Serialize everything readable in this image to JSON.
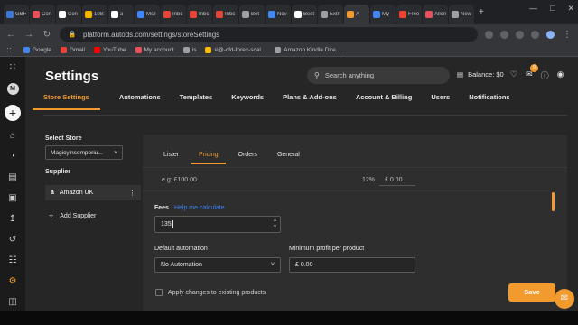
{
  "browser": {
    "tabs": [
      {
        "label": "GBF",
        "color": "#3c78d8"
      },
      {
        "label": "Con",
        "color": "#e8505b"
      },
      {
        "label": "Con",
        "color": "#ffffff"
      },
      {
        "label": "108:",
        "color": "#f4b400"
      },
      {
        "label": "a",
        "color": "#ffffff"
      },
      {
        "label": "McT",
        "color": "#4285f4"
      },
      {
        "label": "Inbc",
        "color": "#ea4335"
      },
      {
        "label": "Inbc",
        "color": "#ea4335"
      },
      {
        "label": "Inbc",
        "color": "#ea4335"
      },
      {
        "label": "Bet",
        "color": "#9aa0a6"
      },
      {
        "label": "Nov",
        "color": "#4285f4"
      },
      {
        "label": "Best",
        "color": "#ffffff"
      },
      {
        "label": "Extr",
        "color": "#9aa0a6"
      },
      {
        "label": "A",
        "color": "#f29a2e",
        "active": true
      },
      {
        "label": "My",
        "color": "#4285f4"
      },
      {
        "label": "Free",
        "color": "#ea4335"
      },
      {
        "label": "Allen",
        "color": "#e8505b"
      },
      {
        "label": "New",
        "color": "#9aa0a6"
      }
    ],
    "url": "platform.autods.com/settings/storeSettings",
    "bookmarks": [
      {
        "label": "Google",
        "color": "#4285f4"
      },
      {
        "label": "Gmail",
        "color": "#ea4335"
      },
      {
        "label": "YouTube",
        "color": "#ff0000"
      },
      {
        "label": "My account",
        "color": "#e8505b"
      },
      {
        "label": "is",
        "color": "#9aa0a6"
      },
      {
        "label": "#@-cfd-forex-scal...",
        "color": "#fbbc05"
      },
      {
        "label": "Amazon Kindle Dire...",
        "color": "#9aa0a6"
      }
    ]
  },
  "sidebar": {
    "avatar_letter": "M"
  },
  "header": {
    "title": "Settings",
    "search_placeholder": "Search anything",
    "balance": "Balance: $0",
    "notification_count": "9"
  },
  "main_tabs": [
    {
      "label": "Store Settings",
      "active": true
    },
    {
      "label": "Automations"
    },
    {
      "label": "Templates"
    },
    {
      "label": "Keywords"
    },
    {
      "label": "Plans & Add-ons"
    },
    {
      "label": "Account & Billing"
    },
    {
      "label": "Users"
    },
    {
      "label": "Notifications"
    }
  ],
  "left": {
    "select_store_label": "Select Store",
    "store_value": "Magicyinsemporiu...",
    "supplier_label": "Supplier",
    "supplier_name": "Amazon UK",
    "add_supplier": "Add Supplier"
  },
  "panel": {
    "subtabs": [
      {
        "label": "Lister"
      },
      {
        "label": "Pricing",
        "active": true
      },
      {
        "label": "Orders"
      },
      {
        "label": "General"
      }
    ],
    "example_text": "e.g: £100.00",
    "example_percent": "12%",
    "example_amount": "£ 0.00",
    "fees_label": "Fees",
    "help_link": "Help me calculate",
    "fees_value": "135",
    "default_automation_label": "Default automation",
    "default_automation_value": "No Automation",
    "min_profit_label": "Minimum profit per product",
    "min_profit_value": "£ 0.00",
    "apply_label": "Apply changes to existing products",
    "save_label": "Save"
  },
  "colors": {
    "accent": "#f29a2e",
    "link": "#3b82f6",
    "background": "#262626"
  }
}
